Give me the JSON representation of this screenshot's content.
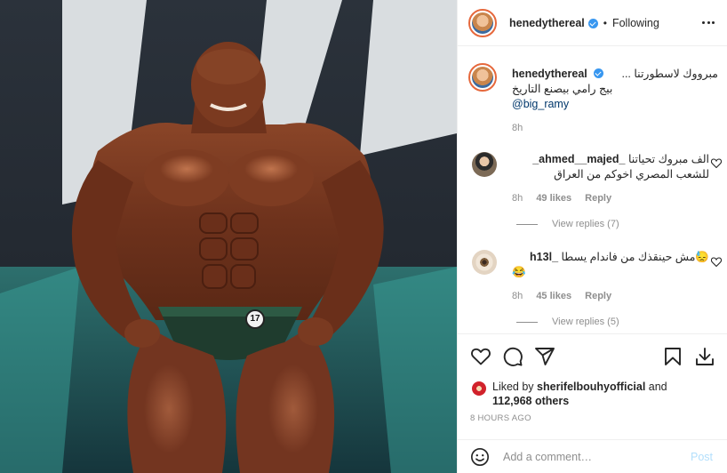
{
  "post": {
    "username": "henedythereal",
    "follow_status": "Following",
    "separator": "•"
  },
  "caption": {
    "username": "henedythereal",
    "line1": "مبرووك لاسطورتنا ...",
    "line2": "بيج رامي بيصنع التاريخ",
    "mention": "@big_ramy",
    "time": "8h"
  },
  "comments": [
    {
      "username": "_ahmed__majed_",
      "text_line1": "الف مبروك تحياتنا",
      "text_line2": "للشعب المصري اخوكم من العراق",
      "time": "8h",
      "likes": "49 likes",
      "reply_label": "Reply",
      "view_replies": "View replies (7)"
    },
    {
      "username": "_h13l",
      "text_line1": "😓مش حينقذك من فاندام يسطا",
      "text_line2": "😂",
      "time": "8h",
      "likes": "45 likes",
      "reply_label": "Reply",
      "view_replies": "View replies (5)"
    }
  ],
  "likes": {
    "prefix": "Liked by",
    "user": "sherifelbouhyofficial",
    "conjunction": "and",
    "count_text": "112,968 others"
  },
  "timestamp": "8 HOURS AGO",
  "add_comment": {
    "placeholder": "Add a comment…",
    "post_label": "Post"
  },
  "photo": {
    "badge_number": "17"
  },
  "colors": {
    "link": "#00376b",
    "verified": "#3897f0",
    "secondary_text": "#8e8e8e",
    "post_button_disabled": "#b2dffc"
  },
  "icons": {
    "more": "more-options-icon",
    "like": "heart-icon",
    "comment": "comment-icon",
    "share": "paper-plane-icon",
    "save": "bookmark-icon",
    "download": "download-icon",
    "emoji": "emoji-icon"
  }
}
